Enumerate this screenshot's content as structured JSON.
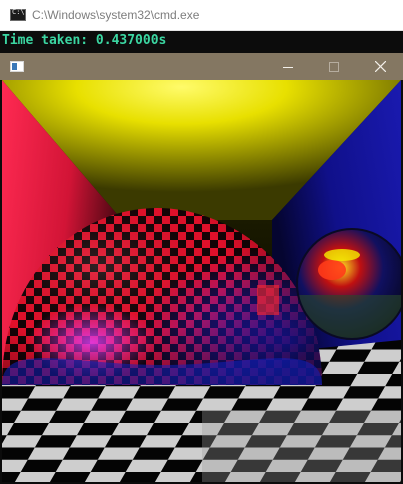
{
  "console": {
    "title": "C:\\Windows\\system32\\cmd.exe",
    "output": "Time taken: 0.437000s",
    "icon": "cmd-icon",
    "text_color": "#3bd6a2"
  },
  "render_window": {
    "titlebar_color": "#847762",
    "icon": "app-icon",
    "buttons": {
      "minimize": "minimize-icon",
      "maximize": "maximize-icon",
      "close": "close-icon"
    },
    "scene": {
      "description_colors": {
        "left_wall": "#e0183a",
        "back_wall": "#0d0d00",
        "ceiling": "#e8e000",
        "right_wall": "#12128e",
        "floor_light": "#ffffff",
        "floor_dark": "#000000"
      }
    }
  }
}
